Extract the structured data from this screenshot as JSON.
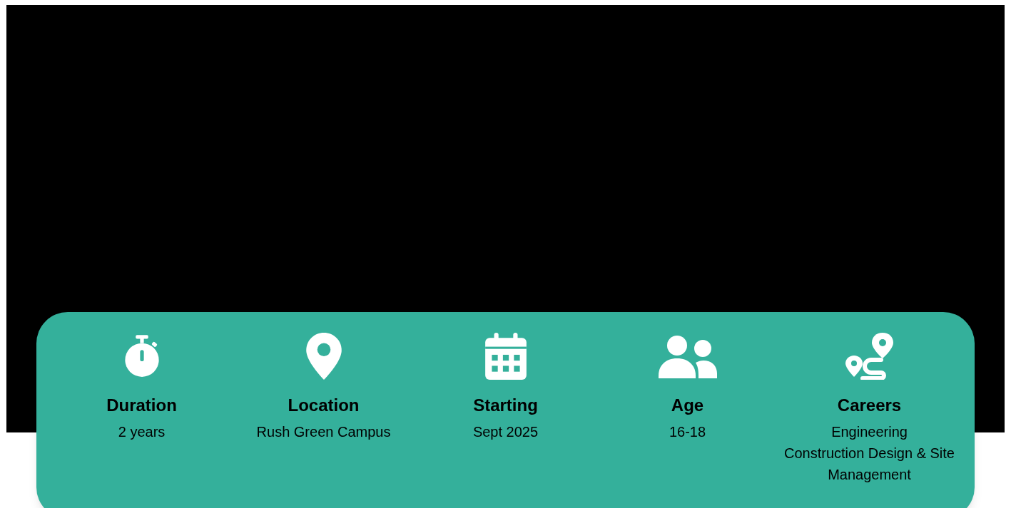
{
  "facts": [
    {
      "kind": "duration",
      "label": "Duration",
      "lines": [
        "2 years"
      ]
    },
    {
      "kind": "location",
      "label": "Location",
      "lines": [
        "Rush Green Campus"
      ]
    },
    {
      "kind": "starting",
      "label": "Starting",
      "lines": [
        "Sept 2025"
      ]
    },
    {
      "kind": "age",
      "label": "Age",
      "lines": [
        "16-18"
      ]
    },
    {
      "kind": "careers",
      "label": "Careers",
      "lines": [
        "Engineering",
        "Construction Design & Site Management"
      ]
    }
  ]
}
